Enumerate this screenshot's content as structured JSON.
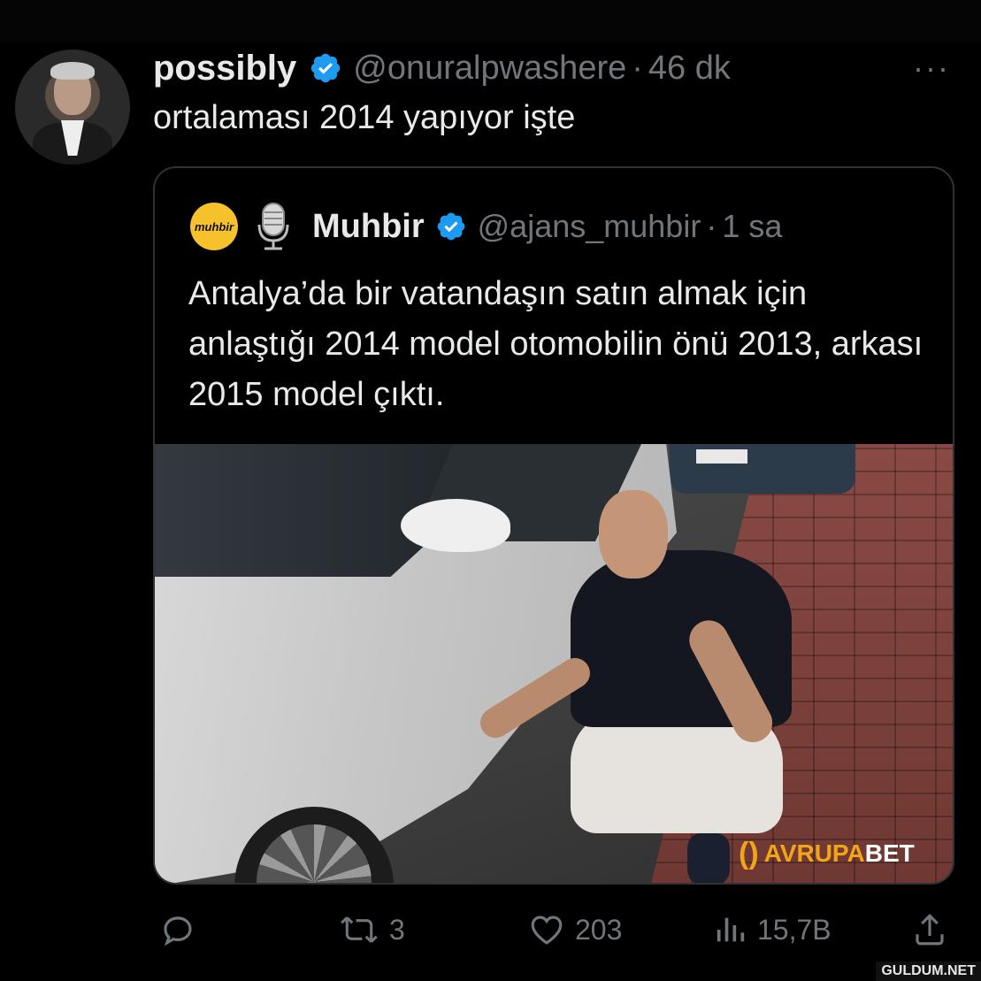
{
  "colors": {
    "background": "#000000",
    "text": "#e7e9ea",
    "muted": "#71767b",
    "verified": "#1d9bf0",
    "muhbir_logo": "#f6c12a"
  },
  "tweet": {
    "display_name": "possibly",
    "handle": "@onuralpwashere",
    "separator": "·",
    "time": "46 dk",
    "more": "···",
    "text": "ortalaması 2014 yapıyor işte",
    "avatar_icon": "profile-photo"
  },
  "quoted": {
    "logo_text": "muhbir",
    "mic_icon": "microphone-icon",
    "display_name": "Muhbir",
    "handle": "@ajans_muhbir",
    "separator": "·",
    "time": "1 sa",
    "text": "Antalya’da bir vatandaşın satın almak için anlaştığı 2014 model otomobilin önü 2013, arkası 2015 model çıktı.",
    "media_watermark": {
      "part1": "AVRUPA",
      "part2": "BET"
    }
  },
  "actions": {
    "reply": {
      "icon": "reply-icon",
      "count": ""
    },
    "retweet": {
      "icon": "retweet-icon",
      "count": "3"
    },
    "like": {
      "icon": "heart-icon",
      "count": "203"
    },
    "views": {
      "icon": "views-icon",
      "count": "15,7B"
    },
    "share": {
      "icon": "share-icon"
    }
  },
  "site_watermark": "GULDUM.NET"
}
